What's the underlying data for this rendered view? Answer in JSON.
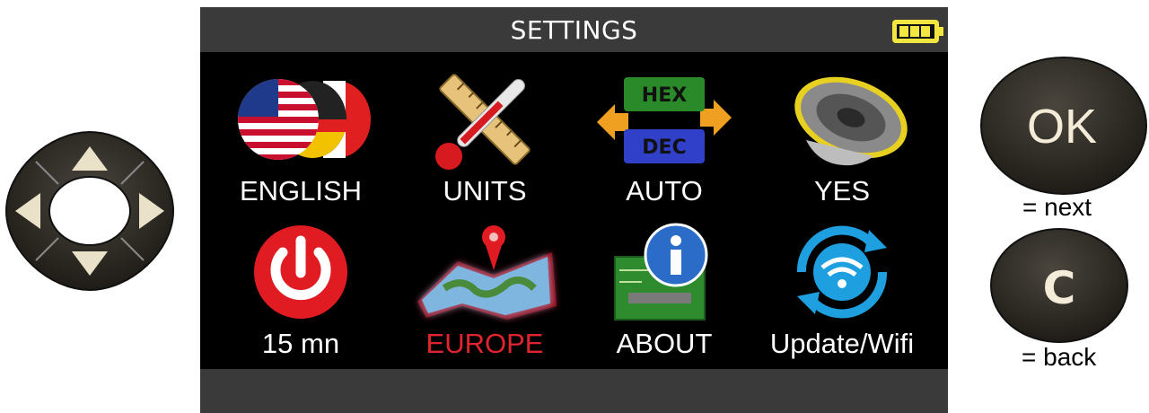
{
  "screen": {
    "title": "SETTINGS",
    "battery_icon": "battery-full-icon",
    "items": [
      {
        "label": "ENGLISH",
        "icon": "language-flags-icon",
        "selected": false
      },
      {
        "label": "UNITS",
        "icon": "units-ruler-thermometer-icon",
        "selected": false
      },
      {
        "label": "AUTO",
        "icon": "hex-dec-toggle-icon",
        "selected": false
      },
      {
        "label": "YES",
        "icon": "speaker-icon",
        "selected": false
      },
      {
        "label": "15 mn",
        "icon": "power-icon",
        "selected": false
      },
      {
        "label": "EUROPE",
        "icon": "map-pin-icon",
        "selected": true
      },
      {
        "label": "ABOUT",
        "icon": "info-circuit-icon",
        "selected": false
      },
      {
        "label": "Update/Wifi",
        "icon": "wifi-update-icon",
        "selected": false
      }
    ],
    "hex_label": "HEX",
    "dec_label": "DEC"
  },
  "controls": {
    "ok_label": "OK",
    "ok_caption": "= next",
    "c_label": "C",
    "c_caption": "= back"
  },
  "colors": {
    "selected_label": "#e0242f",
    "screen_bg": "#000000",
    "bar_bg": "#3a3a3a",
    "button_bg": "#2e2a22",
    "button_text": "#f4ecd8"
  }
}
